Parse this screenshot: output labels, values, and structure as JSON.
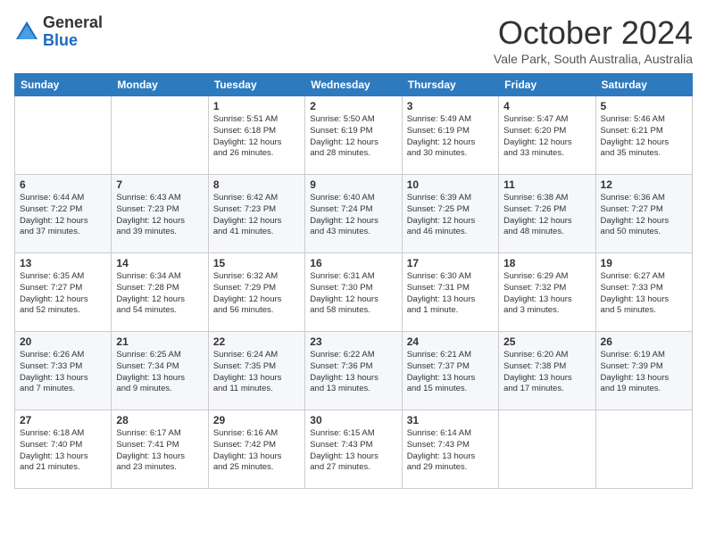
{
  "header": {
    "title": "October 2024",
    "location": "Vale Park, South Australia, Australia",
    "logo_general": "General",
    "logo_blue": "Blue"
  },
  "days_of_week": [
    "Sunday",
    "Monday",
    "Tuesday",
    "Wednesday",
    "Thursday",
    "Friday",
    "Saturday"
  ],
  "weeks": [
    [
      {
        "day": "",
        "info": ""
      },
      {
        "day": "",
        "info": ""
      },
      {
        "day": "1",
        "info": "Sunrise: 5:51 AM\nSunset: 6:18 PM\nDaylight: 12 hours\nand 26 minutes."
      },
      {
        "day": "2",
        "info": "Sunrise: 5:50 AM\nSunset: 6:19 PM\nDaylight: 12 hours\nand 28 minutes."
      },
      {
        "day": "3",
        "info": "Sunrise: 5:49 AM\nSunset: 6:19 PM\nDaylight: 12 hours\nand 30 minutes."
      },
      {
        "day": "4",
        "info": "Sunrise: 5:47 AM\nSunset: 6:20 PM\nDaylight: 12 hours\nand 33 minutes."
      },
      {
        "day": "5",
        "info": "Sunrise: 5:46 AM\nSunset: 6:21 PM\nDaylight: 12 hours\nand 35 minutes."
      }
    ],
    [
      {
        "day": "6",
        "info": "Sunrise: 6:44 AM\nSunset: 7:22 PM\nDaylight: 12 hours\nand 37 minutes."
      },
      {
        "day": "7",
        "info": "Sunrise: 6:43 AM\nSunset: 7:23 PM\nDaylight: 12 hours\nand 39 minutes."
      },
      {
        "day": "8",
        "info": "Sunrise: 6:42 AM\nSunset: 7:23 PM\nDaylight: 12 hours\nand 41 minutes."
      },
      {
        "day": "9",
        "info": "Sunrise: 6:40 AM\nSunset: 7:24 PM\nDaylight: 12 hours\nand 43 minutes."
      },
      {
        "day": "10",
        "info": "Sunrise: 6:39 AM\nSunset: 7:25 PM\nDaylight: 12 hours\nand 46 minutes."
      },
      {
        "day": "11",
        "info": "Sunrise: 6:38 AM\nSunset: 7:26 PM\nDaylight: 12 hours\nand 48 minutes."
      },
      {
        "day": "12",
        "info": "Sunrise: 6:36 AM\nSunset: 7:27 PM\nDaylight: 12 hours\nand 50 minutes."
      }
    ],
    [
      {
        "day": "13",
        "info": "Sunrise: 6:35 AM\nSunset: 7:27 PM\nDaylight: 12 hours\nand 52 minutes."
      },
      {
        "day": "14",
        "info": "Sunrise: 6:34 AM\nSunset: 7:28 PM\nDaylight: 12 hours\nand 54 minutes."
      },
      {
        "day": "15",
        "info": "Sunrise: 6:32 AM\nSunset: 7:29 PM\nDaylight: 12 hours\nand 56 minutes."
      },
      {
        "day": "16",
        "info": "Sunrise: 6:31 AM\nSunset: 7:30 PM\nDaylight: 12 hours\nand 58 minutes."
      },
      {
        "day": "17",
        "info": "Sunrise: 6:30 AM\nSunset: 7:31 PM\nDaylight: 13 hours\nand 1 minute."
      },
      {
        "day": "18",
        "info": "Sunrise: 6:29 AM\nSunset: 7:32 PM\nDaylight: 13 hours\nand 3 minutes."
      },
      {
        "day": "19",
        "info": "Sunrise: 6:27 AM\nSunset: 7:33 PM\nDaylight: 13 hours\nand 5 minutes."
      }
    ],
    [
      {
        "day": "20",
        "info": "Sunrise: 6:26 AM\nSunset: 7:33 PM\nDaylight: 13 hours\nand 7 minutes."
      },
      {
        "day": "21",
        "info": "Sunrise: 6:25 AM\nSunset: 7:34 PM\nDaylight: 13 hours\nand 9 minutes."
      },
      {
        "day": "22",
        "info": "Sunrise: 6:24 AM\nSunset: 7:35 PM\nDaylight: 13 hours\nand 11 minutes."
      },
      {
        "day": "23",
        "info": "Sunrise: 6:22 AM\nSunset: 7:36 PM\nDaylight: 13 hours\nand 13 minutes."
      },
      {
        "day": "24",
        "info": "Sunrise: 6:21 AM\nSunset: 7:37 PM\nDaylight: 13 hours\nand 15 minutes."
      },
      {
        "day": "25",
        "info": "Sunrise: 6:20 AM\nSunset: 7:38 PM\nDaylight: 13 hours\nand 17 minutes."
      },
      {
        "day": "26",
        "info": "Sunrise: 6:19 AM\nSunset: 7:39 PM\nDaylight: 13 hours\nand 19 minutes."
      }
    ],
    [
      {
        "day": "27",
        "info": "Sunrise: 6:18 AM\nSunset: 7:40 PM\nDaylight: 13 hours\nand 21 minutes."
      },
      {
        "day": "28",
        "info": "Sunrise: 6:17 AM\nSunset: 7:41 PM\nDaylight: 13 hours\nand 23 minutes."
      },
      {
        "day": "29",
        "info": "Sunrise: 6:16 AM\nSunset: 7:42 PM\nDaylight: 13 hours\nand 25 minutes."
      },
      {
        "day": "30",
        "info": "Sunrise: 6:15 AM\nSunset: 7:43 PM\nDaylight: 13 hours\nand 27 minutes."
      },
      {
        "day": "31",
        "info": "Sunrise: 6:14 AM\nSunset: 7:43 PM\nDaylight: 13 hours\nand 29 minutes."
      },
      {
        "day": "",
        "info": ""
      },
      {
        "day": "",
        "info": ""
      }
    ]
  ]
}
